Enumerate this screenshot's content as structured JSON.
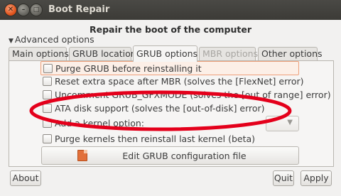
{
  "window": {
    "title": "Boot Repair",
    "heading": "Repair the boot of the computer"
  },
  "expander": {
    "label": "Advanced options"
  },
  "tabs": [
    {
      "label": "Main options",
      "state": "normal"
    },
    {
      "label": "GRUB location",
      "state": "normal"
    },
    {
      "label": "GRUB options",
      "state": "active"
    },
    {
      "label": "MBR options",
      "state": "disabled"
    },
    {
      "label": "Other options",
      "state": "normal"
    }
  ],
  "options": [
    {
      "label": "Purge GRUB before reinstalling it",
      "checked": false
    },
    {
      "label": "Reset extra space after MBR (solves the [FlexNet] error)",
      "checked": false
    },
    {
      "label": "Uncomment GRUB_GFXMODE (solves the [out of range] error)",
      "checked": false
    },
    {
      "label": "ATA disk support (solves the [out-of-disk] error)",
      "checked": false
    },
    {
      "label": "Add a kernel option:",
      "checked": false
    },
    {
      "label": "Purge kernels then reinstall last kernel (beta)",
      "checked": false
    }
  ],
  "edit_button": {
    "label": "Edit GRUB configuration file"
  },
  "buttons": {
    "about": "About",
    "quit": "Quit",
    "apply": "Apply"
  },
  "colors": {
    "annotation": "#e4001b",
    "highlight_border": "#eea07a",
    "titlebar": "#3c3b37"
  }
}
